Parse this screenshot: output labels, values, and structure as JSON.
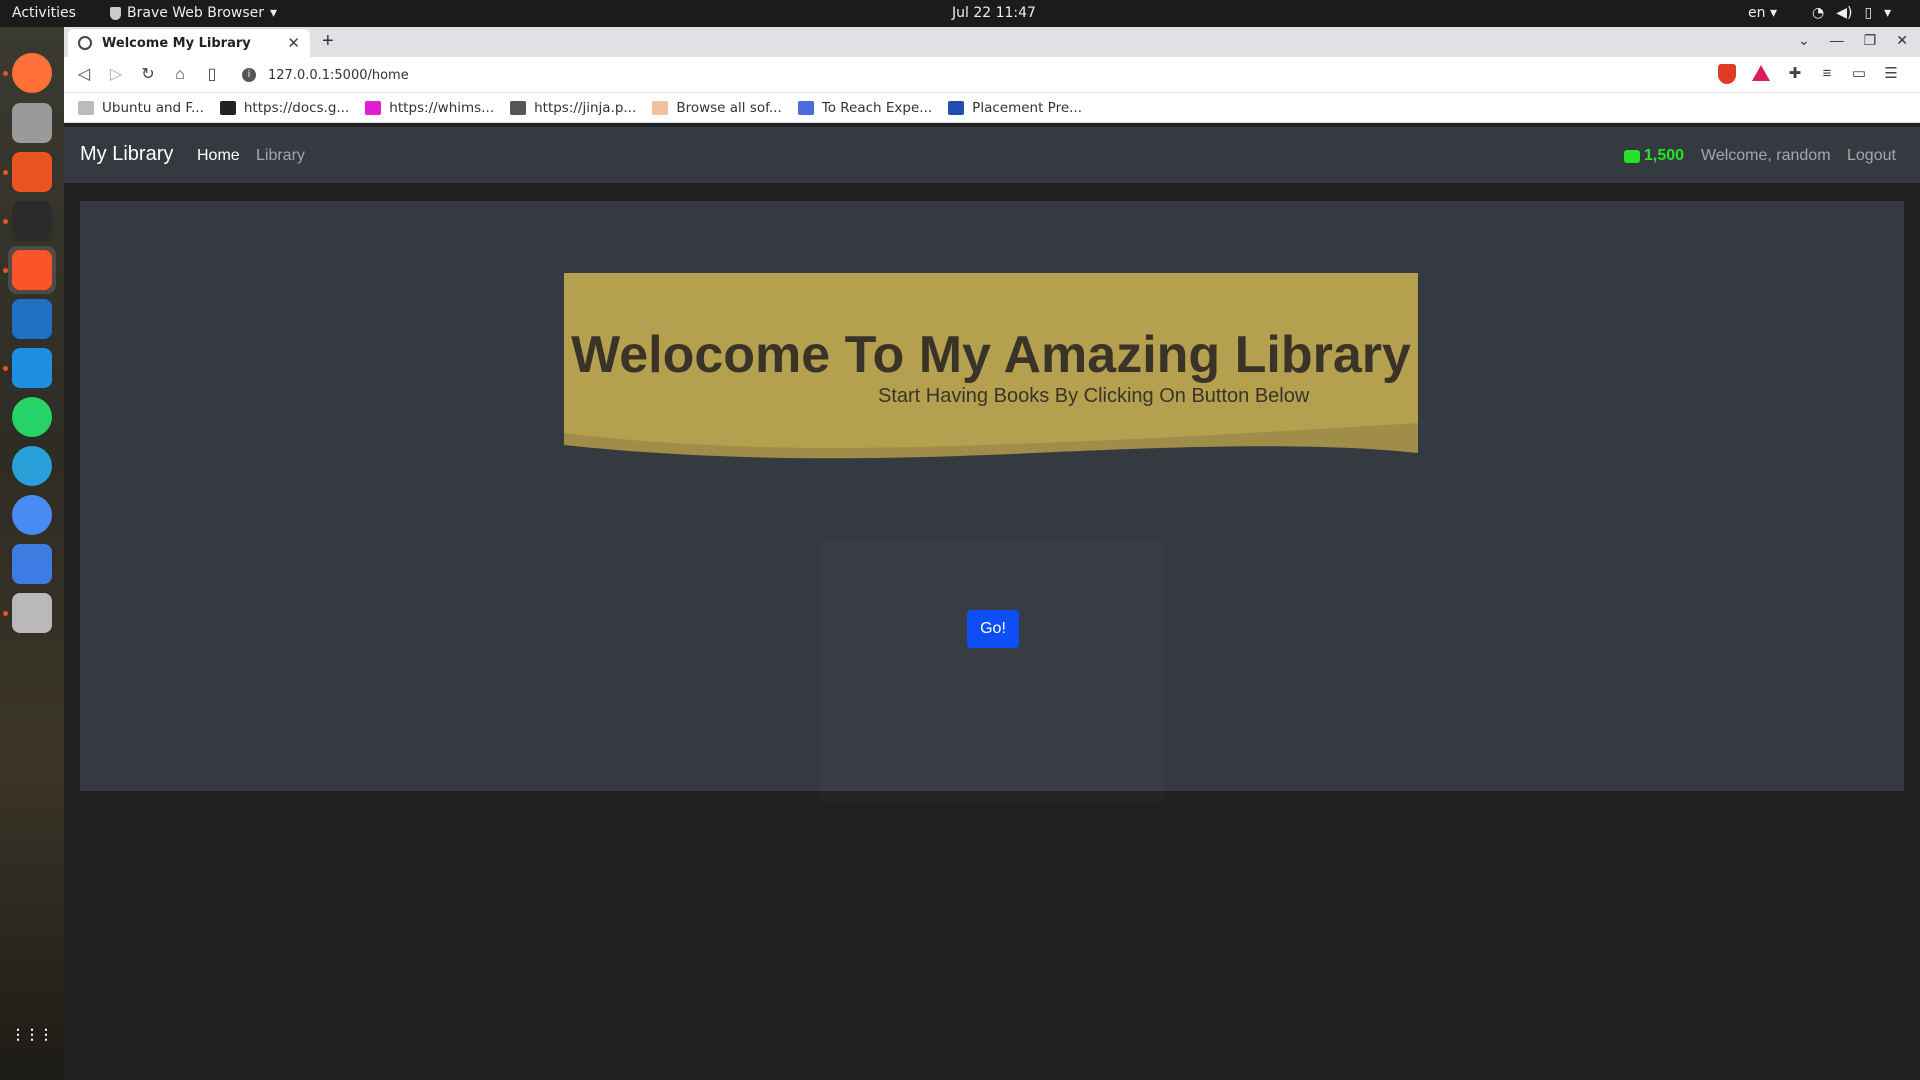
{
  "system": {
    "activities": "Activities",
    "app_menu": "Brave Web Browser",
    "clock": "Jul 22  11:47",
    "language": "en"
  },
  "dock": {
    "items": [
      {
        "name": "firefox-icon",
        "color": "#ff7139"
      },
      {
        "name": "files-icon",
        "color": "#9a9a9a"
      },
      {
        "name": "app-center-icon",
        "color": "#e95420"
      },
      {
        "name": "terminal-icon",
        "color": "#2b2b2b"
      },
      {
        "name": "brave-icon",
        "color": "#fb542b"
      },
      {
        "name": "writer-icon",
        "color": "#1f6fc5"
      },
      {
        "name": "vscode-icon",
        "color": "#1d8fe2"
      },
      {
        "name": "whatsapp-icon",
        "color": "#25d366"
      },
      {
        "name": "telegram-icon",
        "color": "#2aa0da"
      },
      {
        "name": "chromium-icon",
        "color": "#4a8af4"
      },
      {
        "name": "text-editor-icon",
        "color": "#3d7de3"
      },
      {
        "name": "database-icon",
        "color": "#b9b9b9"
      },
      {
        "name": "show-apps-icon",
        "color": "#ffffff"
      }
    ]
  },
  "browser": {
    "tab_title": "Welcome My Library",
    "url": "127.0.0.1:5000/home",
    "bookmarks": [
      {
        "label": "Ubuntu and F...",
        "color": "#bbbbbb"
      },
      {
        "label": "https://docs.g...",
        "color": "#222222"
      },
      {
        "label": "https://whims...",
        "color": "#e11fd1"
      },
      {
        "label": "https://jinja.p...",
        "color": "#555555"
      },
      {
        "label": "Browse all sof...",
        "color": "#f0c0a0"
      },
      {
        "label": "To Reach Expe...",
        "color": "#4a6bd8"
      },
      {
        "label": "Placement Pre...",
        "color": "#1f4fb0"
      }
    ]
  },
  "navbar": {
    "brand": "My Library",
    "home": "Home",
    "library": "Library",
    "budget": "1,500",
    "welcome": "Welcome, random",
    "logout": "Logout"
  },
  "hero": {
    "headline": "Welocome To My Amazing Library",
    "subline": "Start Having Books By Clicking On Button Below",
    "button": "Go!"
  }
}
